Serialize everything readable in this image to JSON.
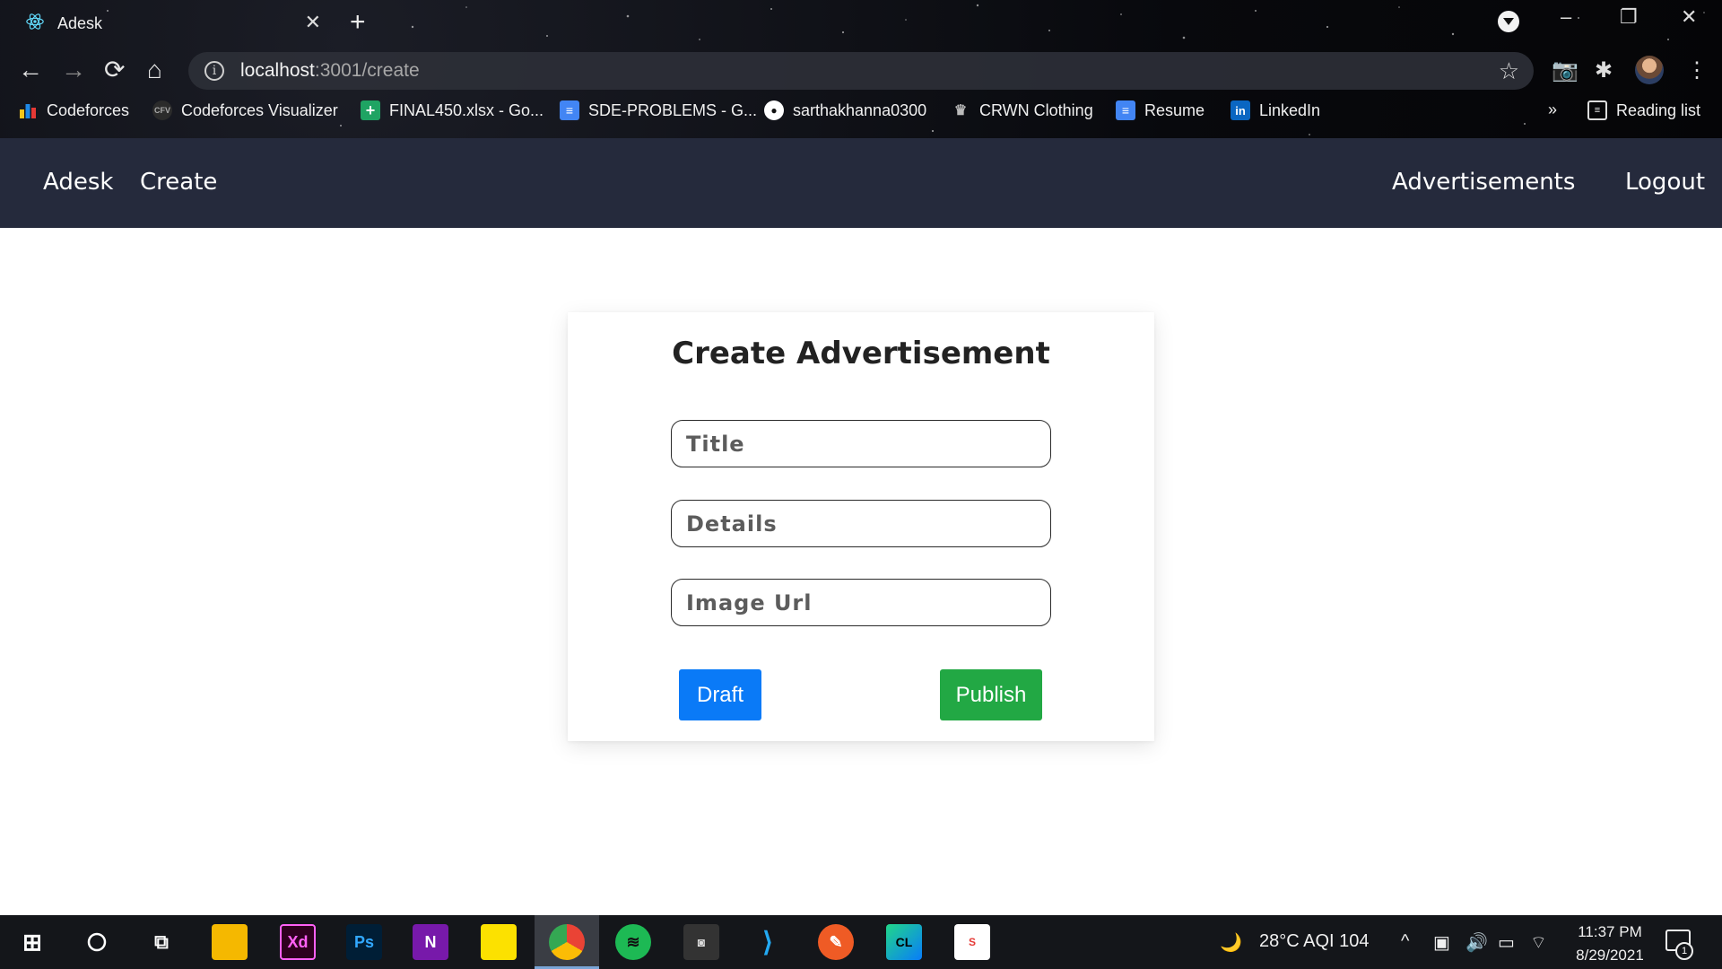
{
  "browser": {
    "tab_title": "Adesk",
    "tab_close": "✕",
    "new_tab": "+",
    "url_host": "localhost",
    "url_path": ":3001/create",
    "bookmarks": [
      {
        "label": "Codeforces",
        "icon": "codeforces-icon"
      },
      {
        "label": "Codeforces Visualizer",
        "icon": "cfv-icon"
      },
      {
        "label": "FINAL450.xlsx - Go...",
        "icon": "google-sheets-icon"
      },
      {
        "label": "SDE-PROBLEMS - G...",
        "icon": "google-docs-icon"
      },
      {
        "label": "sarthakhanna0300",
        "icon": "github-icon"
      },
      {
        "label": "CRWN Clothing",
        "icon": "crown-icon"
      },
      {
        "label": "Resume",
        "icon": "google-docs-icon"
      },
      {
        "label": "LinkedIn",
        "icon": "linkedin-icon"
      }
    ],
    "overflow": "»",
    "reading_list": "Reading list"
  },
  "nav": {
    "brand": "Adesk",
    "create": "Create",
    "advertisements": "Advertisements",
    "logout": "Logout"
  },
  "form": {
    "heading": "Create Advertisement",
    "title_placeholder": "Title",
    "details_placeholder": "Details",
    "image_placeholder": "Image Url",
    "draft_label": "Draft",
    "publish_label": "Publish"
  },
  "taskbar": {
    "weather": "28°C  AQI 104",
    "time": "11:37 PM",
    "date": "8/29/2021",
    "notification_count": "1",
    "apps": [
      "file-explorer-icon",
      "adobe-xd-icon",
      "photoshop-icon",
      "onenote-icon",
      "sticky-notes-icon",
      "chrome-icon",
      "spotify-icon",
      "wsl-icon",
      "vscode-icon",
      "postman-icon",
      "clion-icon",
      "document-icon"
    ]
  },
  "colors": {
    "navbar": "#252a3c",
    "draft": "#0a7af7",
    "publish": "#22a844"
  }
}
